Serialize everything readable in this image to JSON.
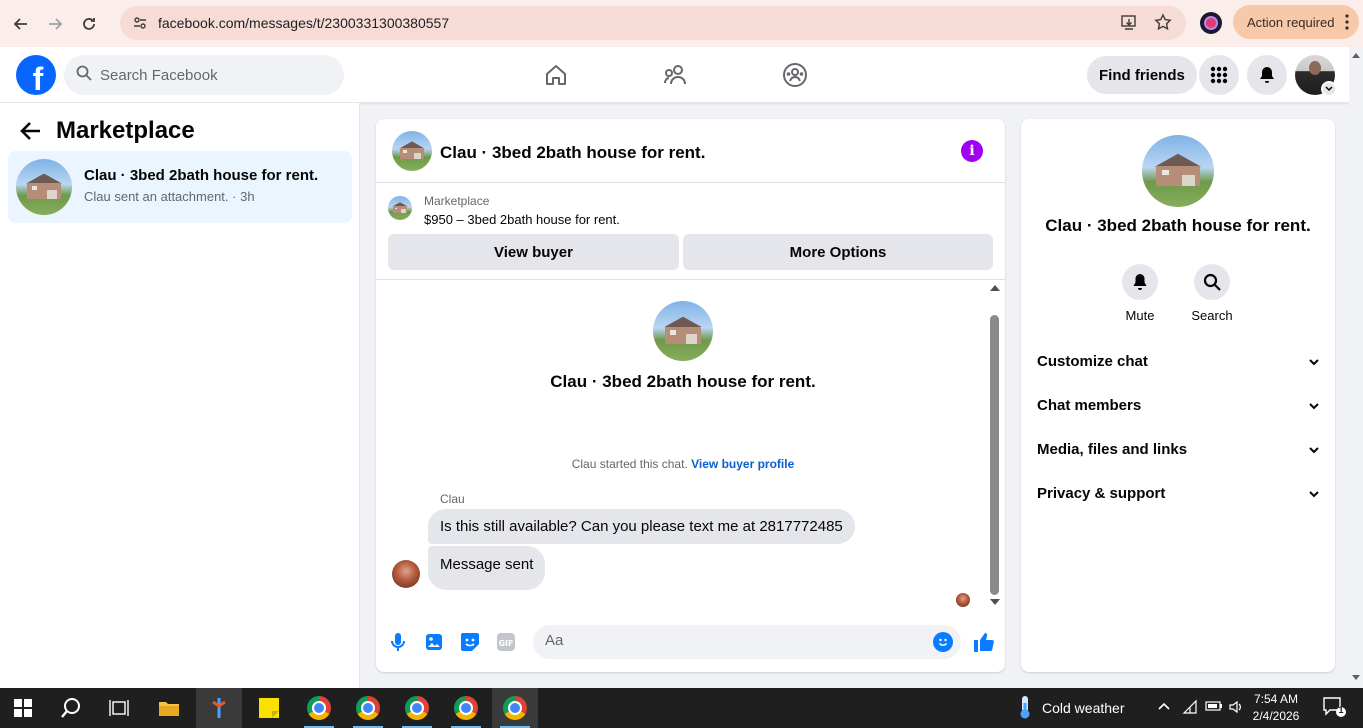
{
  "browser": {
    "url": "facebook.com/messages/t/2300331300380557",
    "action_required": "Action required"
  },
  "fb": {
    "logo_letter": "f",
    "search_placeholder": "Search Facebook",
    "find_friends": "Find friends"
  },
  "left": {
    "title": "Marketplace",
    "thread": {
      "title": "Clau · 3bed 2bath house for rent.",
      "subtitle": "Clau sent an attachment. · 3h"
    }
  },
  "chat": {
    "header_title": "Clau · 3bed 2bath house for rent.",
    "marketplace_label": "Marketplace",
    "listing": "$950 – 3bed 2bath house for rent.",
    "view_buyer": "View buyer",
    "more_options": "More Options",
    "intro_title": "Clau · 3bed 2bath house for rent.",
    "started_text": "Clau started this chat.",
    "view_buyer_profile": "View buyer profile",
    "sender": "Clau",
    "messages": [
      "Is this still available? Can you please text me at 2817772485",
      "Message sent"
    ],
    "composer_placeholder": "Aa"
  },
  "right": {
    "title": "Clau · 3bed 2bath house for rent.",
    "mute": "Mute",
    "search": "Search",
    "sections": [
      "Customize chat",
      "Chat members",
      "Media, files and links",
      "Privacy & support"
    ]
  },
  "taskbar": {
    "weather": "Cold weather",
    "time": "7:54 AM",
    "date": "2/4/2026",
    "notif_count": "1"
  },
  "colors": {
    "fb_blue": "#0866ff",
    "info_purple": "#a100f2",
    "link_blue": "#0a5fd1",
    "selected_thread": "#ebf5ff"
  }
}
